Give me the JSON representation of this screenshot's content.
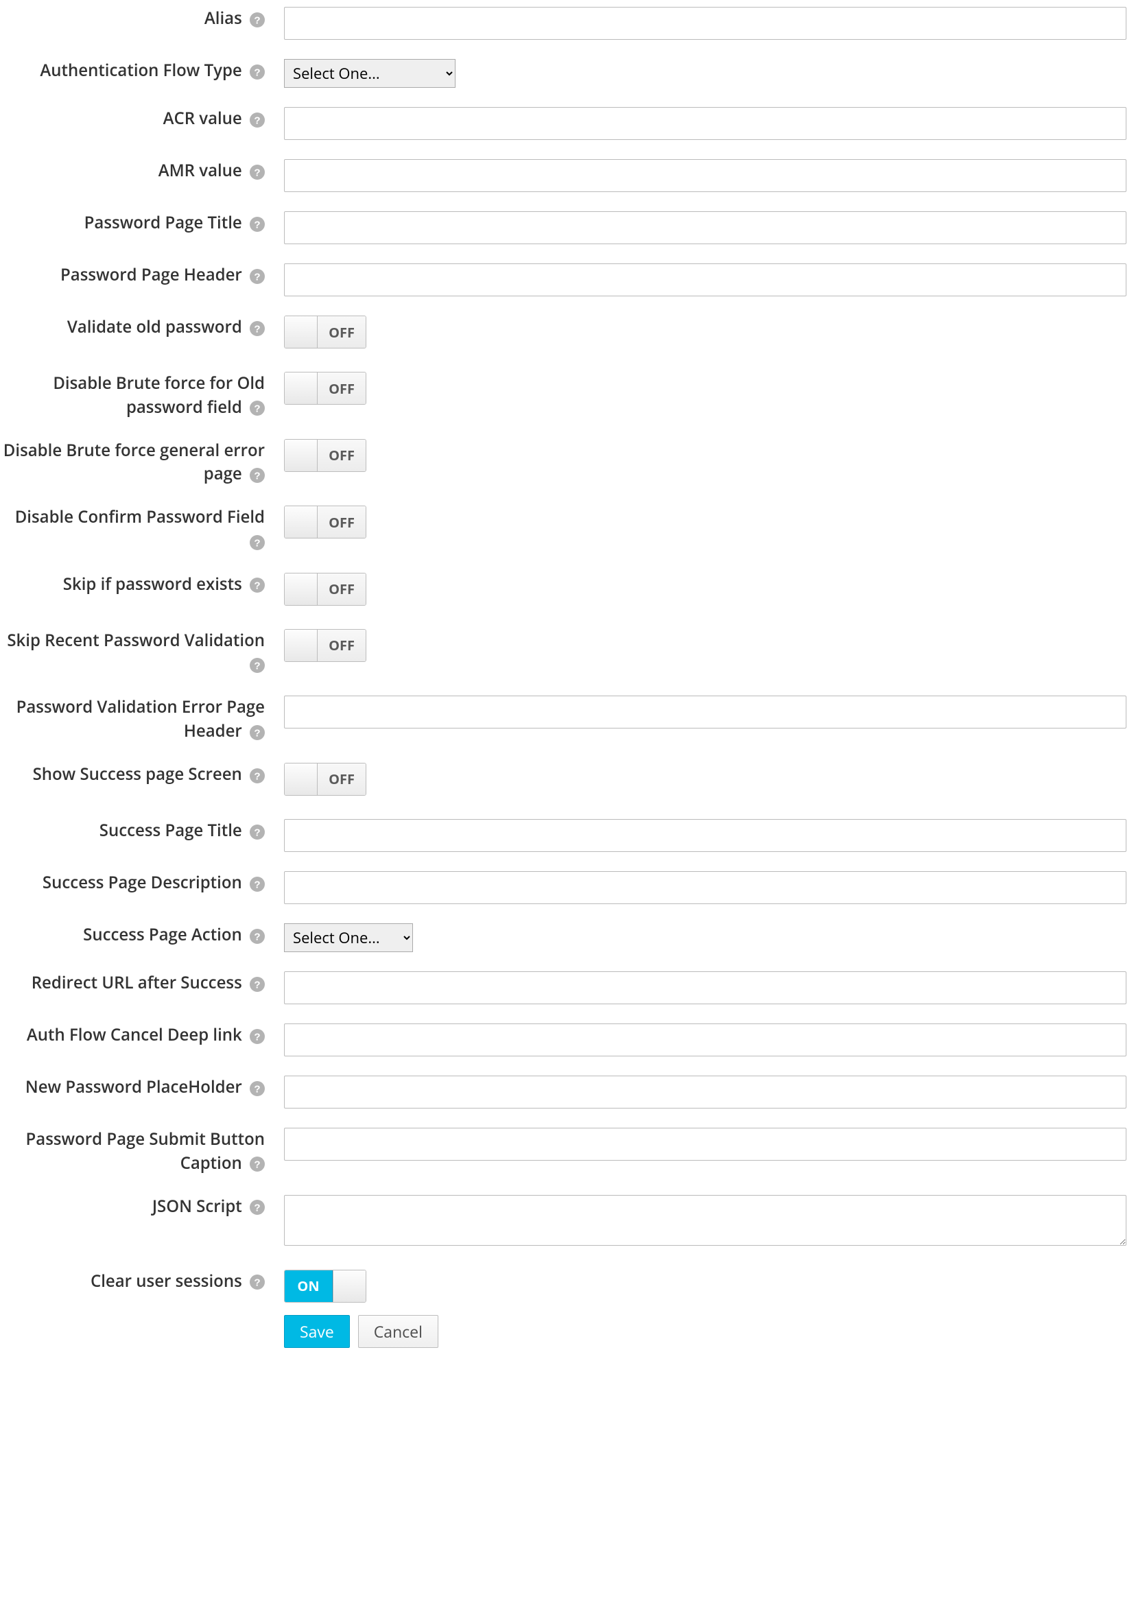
{
  "labels": {
    "alias": "Alias",
    "auth_flow_type": "Authentication Flow Type",
    "acr_value": "ACR value",
    "amr_value": "AMR value",
    "password_page_title": "Password Page Title",
    "password_page_header": "Password Page Header",
    "validate_old_password": "Validate old password",
    "disable_bruteforce_old": "Disable Brute force for Old password field",
    "disable_bruteforce_general": "Disable Brute force general error page",
    "disable_confirm_password": "Disable Confirm Password Field",
    "skip_if_password_exists": "Skip if password exists",
    "skip_recent_password_validation": "Skip Recent Password Validation",
    "password_validation_error_header": "Password Validation Error Page Header",
    "show_success_page_screen": "Show Success page Screen",
    "success_page_title": "Success Page Title",
    "success_page_description": "Success Page Description",
    "success_page_action": "Success Page Action",
    "redirect_url_after_success": "Redirect URL after Success",
    "auth_flow_cancel_deeplink": "Auth Flow Cancel Deep link",
    "new_password_placeholder": "New Password PlaceHolder",
    "password_page_submit_caption": "Password Page Submit Button Caption",
    "json_script": "JSON Script",
    "clear_user_sessions": "Clear user sessions"
  },
  "values": {
    "alias": "",
    "acr_value": "",
    "amr_value": "",
    "password_page_title": "",
    "password_page_header": "",
    "password_validation_error_header": "",
    "success_page_title": "",
    "success_page_description": "",
    "redirect_url_after_success": "",
    "auth_flow_cancel_deeplink": "",
    "new_password_placeholder": "",
    "password_page_submit_caption": "",
    "json_script": ""
  },
  "selects": {
    "auth_flow_type_placeholder": "Select One...",
    "success_page_action_placeholder": "Select One..."
  },
  "toggles": {
    "validate_old_password": "OFF",
    "disable_bruteforce_old": "OFF",
    "disable_bruteforce_general": "OFF",
    "disable_confirm_password": "OFF",
    "skip_if_password_exists": "OFF",
    "skip_recent_password_validation": "OFF",
    "show_success_page_screen": "OFF",
    "clear_user_sessions": "ON"
  },
  "buttons": {
    "save": "Save",
    "cancel": "Cancel"
  }
}
